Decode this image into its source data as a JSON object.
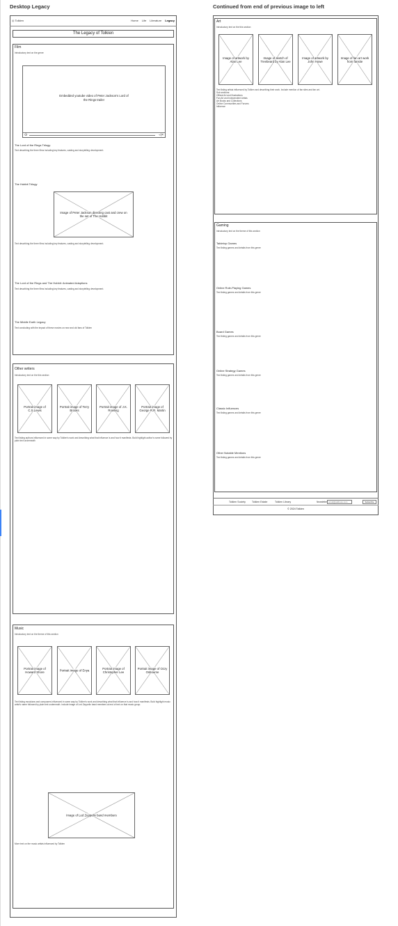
{
  "headers": {
    "desktop": "Desktop Legacy",
    "continued": "Continued from end of previous image to left"
  },
  "nav": {
    "logo": "Tolkien",
    "links": [
      "Home",
      "Life",
      "Literature",
      "Legacy"
    ]
  },
  "page_title": "The Legacy of Tolkien",
  "film": {
    "title": "Film",
    "intro": "Introductory text on the genre",
    "video_label": "Embedded youtube video of Peter Jackson's Lord of the Rings trailer",
    "lotr_heading": "The Lord of the Rings Trilogy",
    "lotr_text": "Text describing the three films including key features, casting and storytelling development.",
    "hobbit_heading": "The Hobbit Trilogy",
    "hobbit_image": "Image of Peter Jackson directing cast and crew on the set of The Hobbit",
    "hobbit_text": "Text describing the three films including key features, casting and storytelling development.",
    "animated_heading": "The Lord of the Rings and The Hobbit: Animated Adaptions",
    "animated_text": "Text describing the three films including key features, casting and storytelling development.",
    "legacy_heading": "The Middle Earth Legacy",
    "legacy_text": "Text concluding with the impact of these movies on new and old fans of Tolkien"
  },
  "writers": {
    "title": "Other writers",
    "intro": "Introductory text on the this section",
    "portraits": [
      "Portrait image of C.S.Lewis",
      "Portrait image of Terry Brooks",
      "Portrait image of J.K. Rowling",
      "Portrait image of George R.R. Martin"
    ],
    "text": "Text listing authors influenced in some way by Tolkien's work and describing what that influence is and how it manifests. Bold highlight author's name followed by plain text underneath"
  },
  "music": {
    "title": "Music",
    "intro": "Introductory text on the theme of this section",
    "portraits": [
      "Portrait image of Howard Shore",
      "Portrait image of Enya",
      "Portrait image of Christopher Lee",
      "Portrait image of Ozzy Osbourne"
    ],
    "text": "Text listing musicians and composers influenced in some way by Tolkien's work and describing what that influence is and how it manifests. Bold highlight music artist's name followed by plain text underneath. Include image of Led Zeppelin band members at end of text on that music group.",
    "band_image": "Image of Led Zeppelin band members",
    "more_text": "More text on the music artists influenced by Tolkien"
  },
  "art": {
    "title": "Art",
    "intro": "Introductory text on the this section",
    "images": [
      "Image of artwork by Alan Lee",
      "Image of sketch of Treebeard by Alan Lee",
      "Image of artwork by John Howe",
      "Image of fan art work from fansite"
    ],
    "text_lines": [
      "Text listing artists influenced by Tolkien and describing their work. Include mention of fan sites and fan art.",
      "Sub sections:",
      "Official Art and Illustrations",
      "Fan Art and Independent Artists",
      "Art Books and Collections",
      "Online Communities and Forums",
      "Influence"
    ]
  },
  "gaming": {
    "title": "Gaming",
    "intro": "Introductory text on the theme of this section",
    "items": [
      {
        "heading": "Tabletop Games",
        "text": "Text listing games and details from this genre"
      },
      {
        "heading": "Online Role-Playing Games",
        "text": "Text listing games and details from this genre"
      },
      {
        "heading": "Board Games",
        "text": "Text listing games and details from this genre"
      },
      {
        "heading": "Online Strategy Games",
        "text": "Text listing games and details from this genre"
      },
      {
        "heading": "Classic Influences",
        "text": "Text listing games and details from this genre"
      },
      {
        "heading": "Other Notable Mentions",
        "text": "Text listing games and details from this genre"
      }
    ]
  },
  "footer": {
    "links": [
      "Tolkien Society",
      "Tolkien Estate",
      "Tolkien Library"
    ],
    "newsletter_label": "Newsletter",
    "email_placeholder": "email@address.com",
    "subscribe": "Subscribe",
    "copyright": "© 2024 Tolkien"
  }
}
